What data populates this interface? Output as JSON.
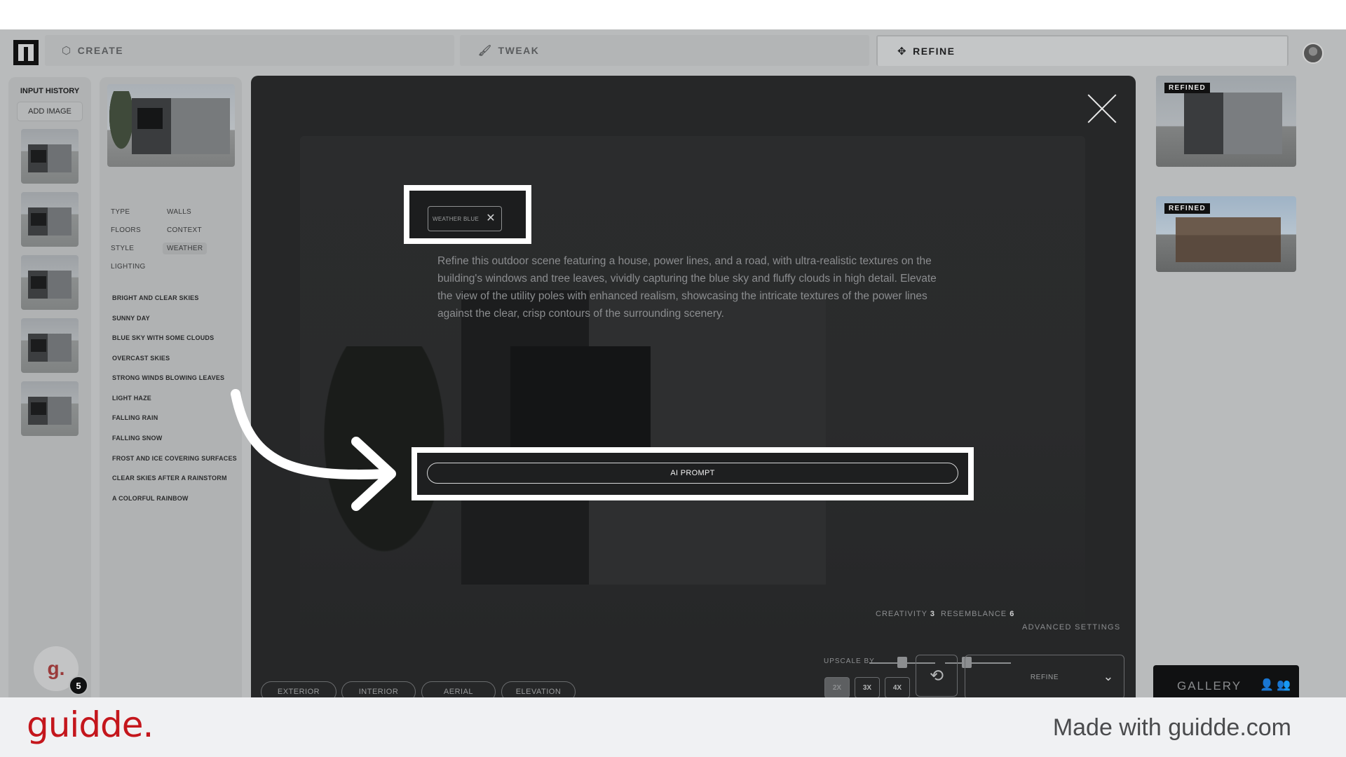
{
  "tabs": {
    "create": "CREATE",
    "tweak": "TWEAK",
    "refine": "REFINE"
  },
  "history": {
    "title": "INPUT HISTORY",
    "add_image": "ADD IMAGE"
  },
  "options": {
    "categories": [
      "TYPE",
      "WALLS",
      "FLOORS",
      "CONTEXT",
      "STYLE",
      "WEATHER",
      "LIGHTING"
    ],
    "weather_options": [
      "BRIGHT AND CLEAR SKIES",
      "SUNNY DAY",
      "BLUE SKY WITH SOME CLOUDS",
      "OVERCAST SKIES",
      "STRONG WINDS BLOWING LEAVES",
      "LIGHT HAZE",
      "FALLING RAIN",
      "FALLING SNOW",
      "FROST AND ICE COVERING SURFACES",
      "CLEAR SKIES AFTER A RAINSTORM",
      "A COLORFUL RAINBOW"
    ]
  },
  "modal": {
    "tag": "WEATHER BLUE",
    "prompt": "Refine this outdoor scene featuring a house, power lines, and a road, with ultra-realistic textures on the building's windows and tree leaves, vividly capturing the blue sky and fluffy clouds in high detail. Elevate the view of the utility poles with enhanced realism, showcasing the intricate textures of the power lines against the clear, crisp contours of the surrounding scenery.",
    "ai_prompt": "AI PROMPT",
    "creativity_label": "CREATIVITY",
    "creativity_value": "3",
    "resemblance_label": "RESEMBLANCE",
    "resemblance_value": "6",
    "advanced": "ADVANCED SETTINGS",
    "upscale_label": "UPSCALE BY",
    "upscale_options": [
      "2X",
      "3X",
      "4X"
    ],
    "refine_button": "REFINE",
    "view_pills": [
      "EXTERIOR",
      "INTERIOR",
      "AERIAL",
      "ELEVATION"
    ]
  },
  "right_panel": {
    "badge": "REFINED",
    "gallery": "GALLERY"
  },
  "guidde": {
    "badge_letter": "g.",
    "count": "5",
    "footer_logo": "guidde.",
    "footer_text": "Made with guidde.com"
  },
  "colors": {
    "accent": "#c4161c",
    "modal_bg": "#262728",
    "highlight": "#ffffff"
  }
}
